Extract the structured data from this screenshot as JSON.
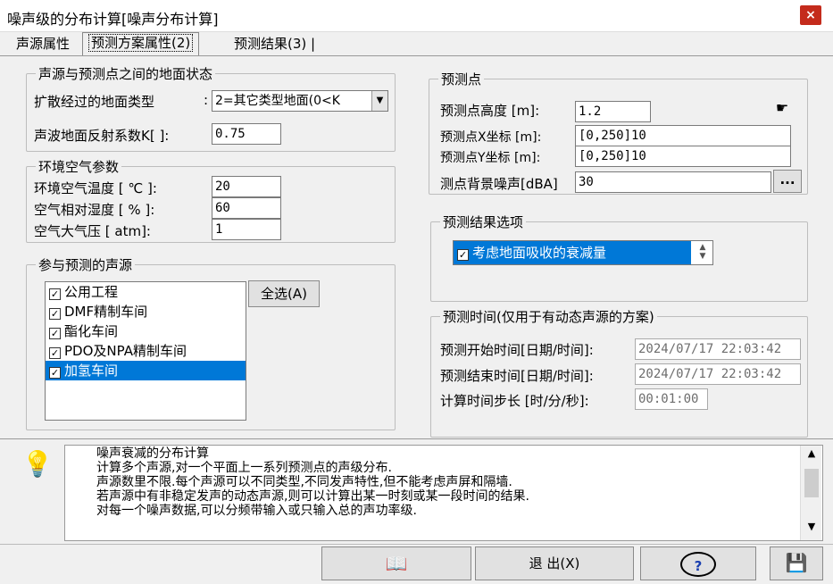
{
  "window": {
    "title": "噪声级的分布计算[噪声分布计算]",
    "close": "×"
  },
  "tabs": [
    {
      "label": "声源属性"
    },
    {
      "label": "预测方案属性(2)"
    },
    {
      "label": "预测结果(3)"
    }
  ],
  "ground": {
    "title": "声源与预测点之间的地面状态",
    "type_label": "扩散经过的地面类型",
    "type_colon": ":",
    "type_value": "2=其它类型地面(0<K",
    "reflect_label": "声波地面反射系数K[ ]:",
    "reflect_value": "0.75"
  },
  "air": {
    "title": "环境空气参数",
    "temp_label": "环境空气温度  [ ℃ ]:",
    "temp_value": "20",
    "humidity_label": "空气相对湿度  [  % ]:",
    "humidity_value": "60",
    "pressure_label": "空气大气压    [ atm]:",
    "pressure_value": "1"
  },
  "sources": {
    "title": "参与预测的声源",
    "select_all": "全选(A)",
    "items": [
      "公用工程",
      "DMF精制车间",
      "酯化车间",
      "PDO及NPA精制车间",
      "加氢车间"
    ],
    "selected_index": 4
  },
  "point": {
    "title": "预测点",
    "height_label": "预测点高度  [m]:",
    "height_value": "1.2",
    "x_label": "预测点X坐标 [m]:",
    "x_value": "[0,250]10",
    "y_label": "预测点Y坐标 [m]:",
    "y_value": "[0,250]10",
    "bg_label": "测点背景噪声[dBA]",
    "bg_value": "30",
    "more": "..."
  },
  "options": {
    "title": "预测结果选项",
    "item": "考虑地面吸收的衰减量"
  },
  "time": {
    "title": "预测时间(仅用于有动态声源的方案)",
    "start_label": "预测开始时间[日期/时间]:",
    "start_value": "2024/07/17 22:03:42",
    "end_label": "预测结束时间[日期/时间]:",
    "end_value": "2024/07/17 22:03:42",
    "step_label": "计算时间步长 [时/分/秒]:",
    "step_value": "00:01:00"
  },
  "info": {
    "lines": [
      "噪声衰减的分布计算",
      "计算多个声源,对一个平面上一系列预测点的声级分布.",
      "声源数里不限.每个声源可以不同类型,不同发声特性,但不能考虑声屏和隔墙.",
      "若声源中有非稳定发声的动态声源,则可以计算出某一时刻或某一段时间的结果.",
      "对每一个噪声数据,可以分频带输入或只输入总的声功率级."
    ]
  },
  "buttons": {
    "exit": "退 出(X)",
    "help": "?"
  },
  "colors": {
    "selection": "#0078d7",
    "close": "#c42b1c"
  }
}
